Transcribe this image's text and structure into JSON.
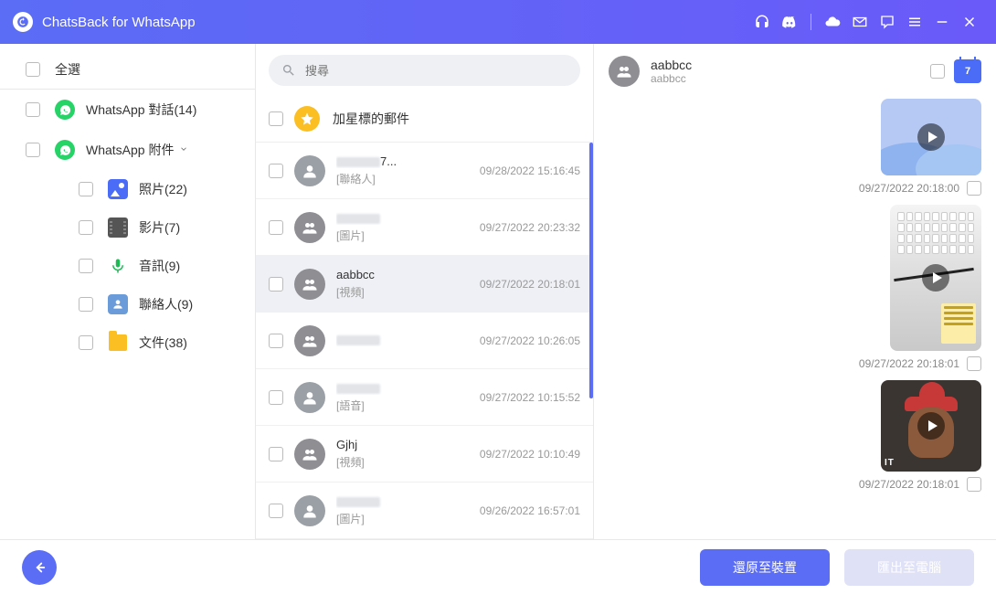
{
  "app": {
    "title": "ChatsBack for WhatsApp"
  },
  "sidebar": {
    "select_all": "全選",
    "chats": "WhatsApp 對話(14)",
    "attachments": "WhatsApp 附件",
    "photos": "照片(22)",
    "videos": "影片(7)",
    "audio": "音訊(9)",
    "contacts": "聯絡人(9)",
    "files": "文件(38)"
  },
  "search": {
    "placeholder": "搜尋"
  },
  "starred": {
    "label": "加星標的郵件"
  },
  "chats": [
    {
      "name_suffix": "7...",
      "type": "[聯絡人]",
      "ts": "09/28/2022 15:16:45",
      "group": false,
      "blur": true
    },
    {
      "name_suffix": "",
      "type": "[圖片]",
      "ts": "09/27/2022 20:23:32",
      "group": true,
      "blur": true
    },
    {
      "name": "aabbcc",
      "type": "[視頻]",
      "ts": "09/27/2022 20:18:01",
      "group": true,
      "selected": true
    },
    {
      "name_suffix": "",
      "type": "",
      "ts": "09/27/2022 10:26:05",
      "group": true,
      "blur": true,
      "blur2": true
    },
    {
      "name_suffix": "",
      "type": "[語音]",
      "ts": "09/27/2022 10:15:52",
      "group": false,
      "blur": true
    },
    {
      "name": "Gjhj",
      "type": "[視頻]",
      "ts": "09/27/2022 10:10:49",
      "group": true
    },
    {
      "name_suffix": "",
      "type": "[圖片]",
      "ts": "09/26/2022 16:57:01",
      "group": false,
      "blur": true
    }
  ],
  "detail": {
    "name": "aabbcc",
    "sub": "aabbcc",
    "cal_day": "7",
    "messages": [
      {
        "ts": "09/27/2022 20:18:00",
        "thumb": "blue"
      },
      {
        "ts": "09/27/2022 20:18:01",
        "thumb": "photo1"
      },
      {
        "ts": "09/27/2022 20:18:01",
        "thumb": "gif",
        "gif_tag": "IT"
      }
    ]
  },
  "buttons": {
    "restore": "還原至裝置",
    "export": "匯出至電腦"
  }
}
